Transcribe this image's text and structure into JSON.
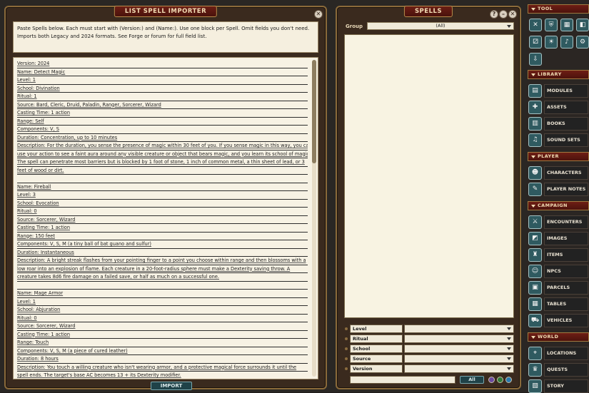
{
  "importer": {
    "title": "List Spell Importer",
    "close_icon": "close-icon",
    "help_text": "Paste Spells below. Each must start with (Version:) and (Name:). Use one block per Spell. Omit fields you don't need. Imports both Legacy and 2024 formats. See Forge or forum for full field list.",
    "lines": [
      "Version: 2024",
      "Name: Detect Magic",
      "Level: 1",
      "School: Divination",
      "Ritual: 1",
      "Source: Bard, Cleric, Druid, Paladin, Ranger, Sorcerer, Wizard",
      "Casting Time: 1 action",
      "Range: Self",
      "Components: V, S",
      "Duration: Concentration, up to 10 minutes",
      "Description: For the duration, you sense the presence of magic within 30 feet of you. If you sense magic in this way, you can",
      "use your action to see a faint aura around any visible creature or object that bears magic, and you learn its school of magic.",
      "The spell can penetrate most barriers but is blocked by 1 foot of stone, 1 inch of common metal, a thin sheet of lead, or 3",
      "feet of wood or dirt.",
      "",
      "Name: Fireball",
      "Level: 3",
      "School: Evocation",
      "Ritual: 0",
      "Source: Sorcerer, Wizard",
      "Casting Time: 1 action",
      "Range: 150 feet",
      "Components: V, S, M (a tiny ball of bat guano and sulfur)",
      "Duration: Instantaneous",
      "Description: A bright streak flashes from your pointing finger to a point you choose within range and then blossoms with a",
      "low roar into an explosion of flame. Each creature in a 20-foot-radius sphere must make a Dexterity saving throw. A",
      "creature takes 8d6 fire damage on a failed save, or half as much on a successful one.",
      "",
      "Name: Mage Armor",
      "Level: 1",
      "School: Abjuration",
      "Ritual: 0",
      "Source: Sorcerer, Wizard",
      "Casting Time: 1 action",
      "Range: Touch",
      "Components: V, S, M (a piece of cured leather)",
      "Duration: 8 hours",
      "Description: You touch a willing creature who isn't wearing armor, and a protective magical force surrounds it until the",
      "spell ends. The target's base AC becomes 13 + its Dexterity modifier."
    ],
    "import_label": "IMPORT"
  },
  "spells": {
    "title": "Spells",
    "group_label": "Group",
    "group_value": "(All)",
    "filters": [
      "Level",
      "Ritual",
      "School",
      "Source",
      "Version"
    ],
    "all_label": "All",
    "chip_colors": [
      "#6a4aa0",
      "#2f7a3a",
      "#2a7ab0"
    ]
  },
  "sidebar": {
    "tool_header": "Tool",
    "tool_icons": [
      "close-icon",
      "shield-icon",
      "calendar-icon",
      "image-icon",
      "dice-icon",
      "lightbulb-icon",
      "music-icon",
      "gear-icon",
      "export-icon"
    ],
    "library_header": "Library",
    "library_items": [
      {
        "label": "MODULES",
        "icon": "modules-icon"
      },
      {
        "label": "ASSETS",
        "icon": "assets-icon"
      },
      {
        "label": "BOOKS",
        "icon": "books-icon"
      },
      {
        "label": "SOUND SETS",
        "icon": "sound-icon"
      }
    ],
    "player_header": "Player",
    "player_items": [
      {
        "label": "CHARACTERS",
        "icon": "characters-icon"
      },
      {
        "label": "PLAYER NOTES",
        "icon": "notes-icon"
      }
    ],
    "campaign_header": "Campaign",
    "campaign_items": [
      {
        "label": "ENCOUNTERS",
        "icon": "encounters-icon"
      },
      {
        "label": "IMAGES",
        "icon": "images-icon"
      },
      {
        "label": "ITEMS",
        "icon": "items-icon"
      },
      {
        "label": "NPCS",
        "icon": "npcs-icon"
      },
      {
        "label": "PARCELS",
        "icon": "parcels-icon"
      },
      {
        "label": "TABLES",
        "icon": "tables-icon"
      },
      {
        "label": "VEHICLES",
        "icon": "vehicles-icon"
      }
    ],
    "world_header": "World",
    "world_items": [
      {
        "label": "LOCATIONS",
        "icon": "locations-icon"
      },
      {
        "label": "QUESTS",
        "icon": "quests-icon"
      },
      {
        "label": "STORY",
        "icon": "story-icon"
      }
    ]
  }
}
